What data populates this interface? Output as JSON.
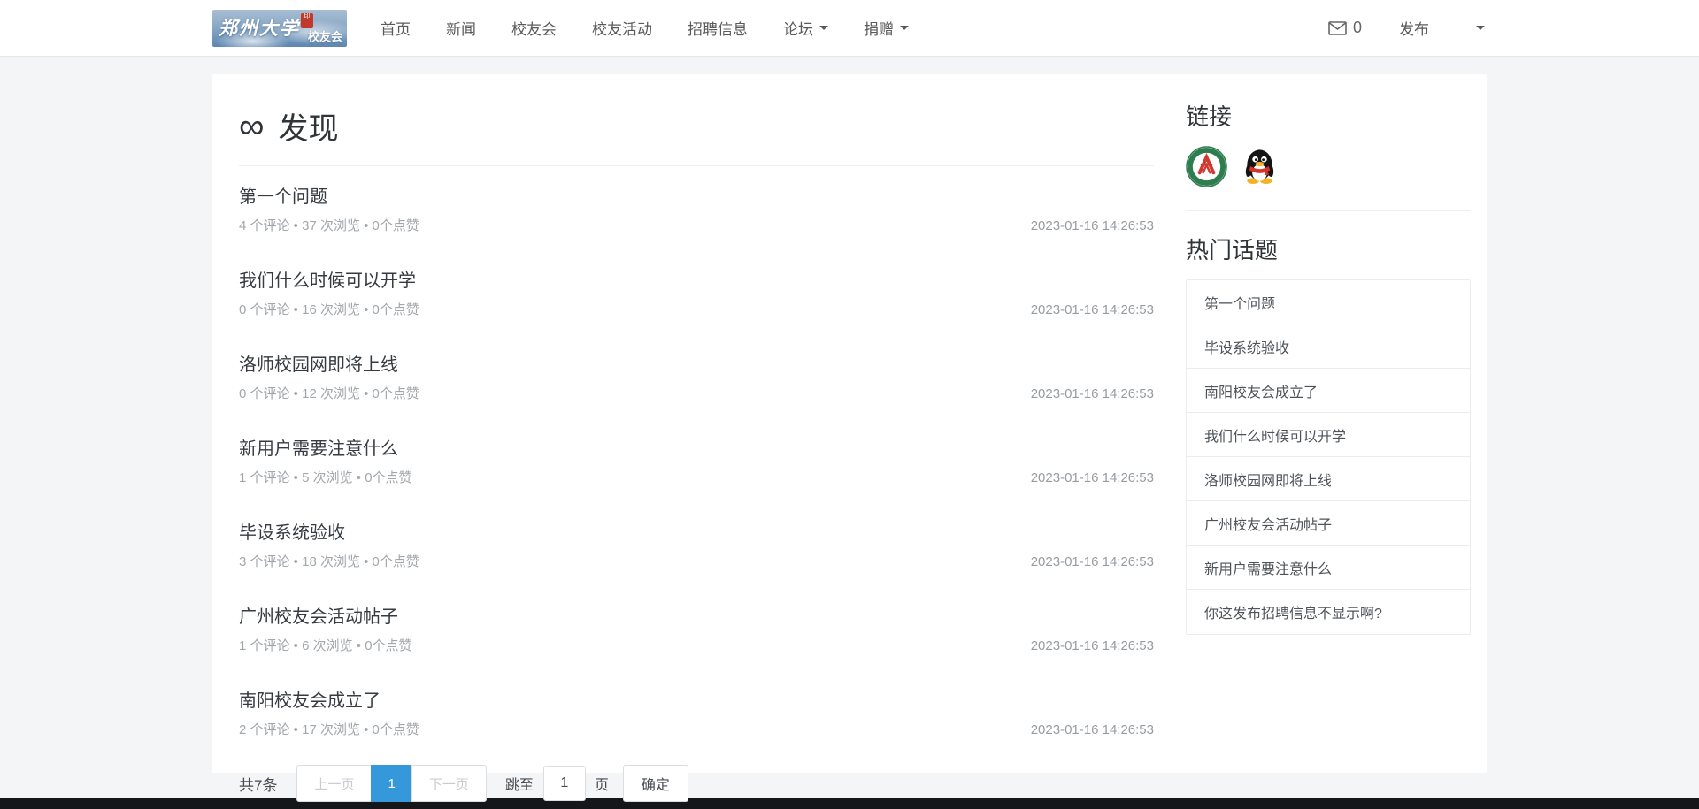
{
  "colors": {
    "accent": "#3498db",
    "body-bg": "#f3f5f7",
    "footer-bg": "#14161a"
  },
  "navbar": {
    "logo": {
      "name": "郑州大学",
      "sub": "校友会"
    },
    "items": [
      {
        "label": "首页"
      },
      {
        "label": "新闻"
      },
      {
        "label": "校友会"
      },
      {
        "label": "校友活动"
      },
      {
        "label": "招聘信息"
      },
      {
        "label": "论坛",
        "dropdown": true
      },
      {
        "label": "捐赠",
        "dropdown": true
      }
    ],
    "message_count": "0",
    "publish": "发布"
  },
  "main": {
    "heading": "发现",
    "topics": [
      {
        "title": "第一个问题",
        "meta": "4 个评论 • 37 次浏览 • 0个点赞",
        "time": "2023-01-16 14:26:53"
      },
      {
        "title": "我们什么时候可以开学",
        "meta": "0 个评论 • 16 次浏览 • 0个点赞",
        "time": "2023-01-16 14:26:53"
      },
      {
        "title": "洛师校园网即将上线",
        "meta": "0 个评论 • 12 次浏览 • 0个点赞",
        "time": "2023-01-16 14:26:53"
      },
      {
        "title": "新用户需要注意什么",
        "meta": "1 个评论 • 5 次浏览 • 0个点赞",
        "time": "2023-01-16 14:26:53"
      },
      {
        "title": "毕设系统验收",
        "meta": "3 个评论 • 18 次浏览 • 0个点赞",
        "time": "2023-01-16 14:26:53"
      },
      {
        "title": "广州校友会活动帖子",
        "meta": "1 个评论 • 6 次浏览 • 0个点赞",
        "time": "2023-01-16 14:26:53"
      },
      {
        "title": "南阳校友会成立了",
        "meta": "2 个评论 • 17 次浏览 • 0个点赞",
        "time": "2023-01-16 14:26:53"
      }
    ],
    "pagination": {
      "total": "共7条",
      "prev": "上一页",
      "page": "1",
      "next": "下一页",
      "jump_label": "跳至",
      "jump_value": "1",
      "unit": "页",
      "confirm": "确定"
    }
  },
  "sidebar": {
    "links_heading": "链接",
    "links": [
      {
        "icon": "zhengzhou-university-badge"
      },
      {
        "icon": "qq-penguin"
      }
    ],
    "hot_heading": "热门话题",
    "hot_topics": [
      "第一个问题",
      "毕设系统验收",
      "南阳校友会成立了",
      "我们什么时候可以开学",
      "洛师校园网即将上线",
      "广州校友会活动帖子",
      "新用户需要注意什么",
      "你这发布招聘信息不显示啊?"
    ]
  }
}
